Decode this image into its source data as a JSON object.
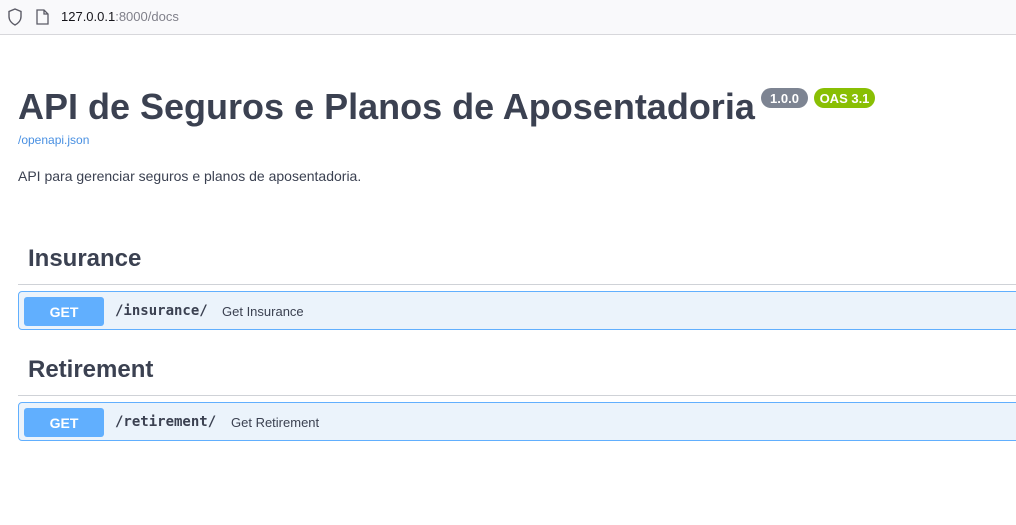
{
  "browser": {
    "url_host": "127.0.0.1",
    "url_rest": ":8000/docs"
  },
  "info": {
    "title": "API de Seguros e Planos de Aposentadoria",
    "version": "1.0.0",
    "oas": "OAS 3.1",
    "openapi_link": "/openapi.json",
    "description": "API para gerenciar seguros e planos de aposentadoria."
  },
  "sections": [
    {
      "title": "Insurance",
      "operations": [
        {
          "method": "GET",
          "path": "/insurance/",
          "summary": "Get Insurance"
        }
      ]
    },
    {
      "title": "Retirement",
      "operations": [
        {
          "method": "GET",
          "path": "/retirement/",
          "summary": "Get Retirement"
        }
      ]
    }
  ],
  "colors": {
    "get_accent": "#61affe",
    "get_background": "#ebf3fb",
    "version_badge": "#7d8492",
    "oas_badge": "#89bf04",
    "link": "#4990e2"
  }
}
